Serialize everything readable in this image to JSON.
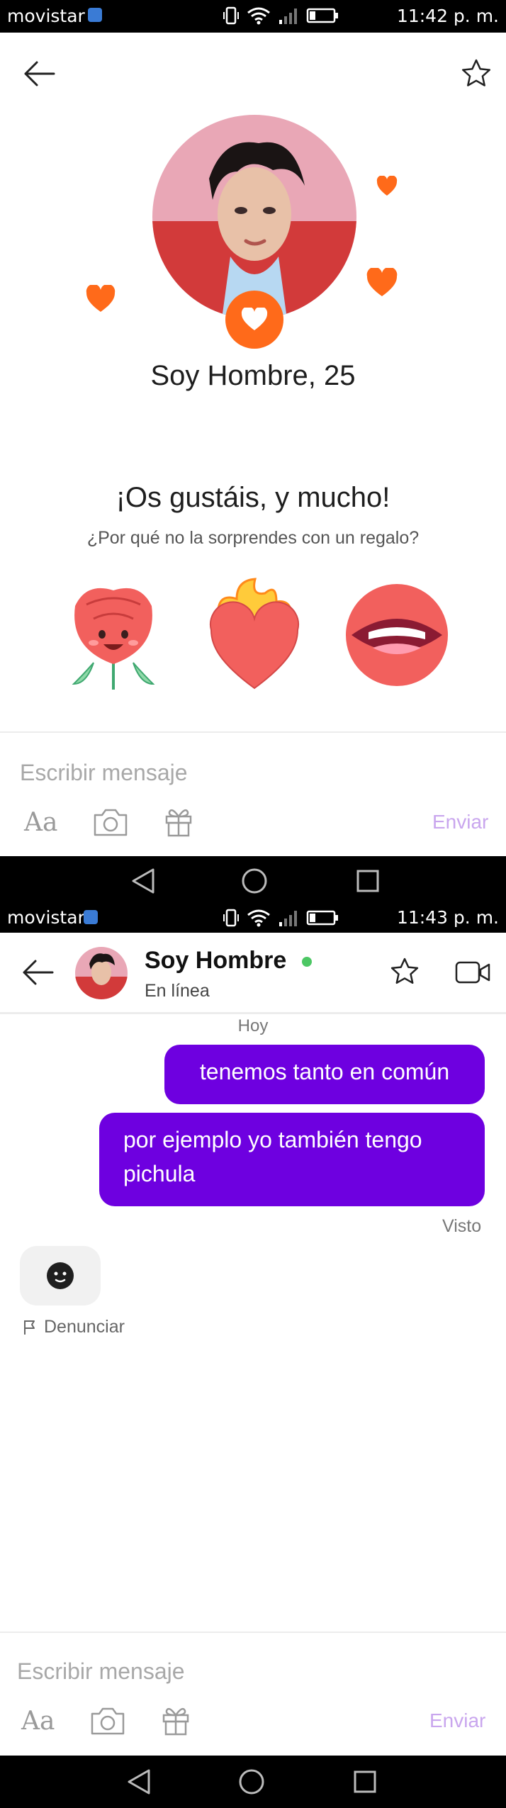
{
  "status_bar_1": {
    "carrier": "movistar",
    "time": "11:42 p. m."
  },
  "status_bar_2": {
    "carrier": "movistar",
    "time": "11:43 p. m."
  },
  "match_screen": {
    "profile_name": "Soy Hombre, 25",
    "headline": "¡Os gustáis, y mucho!",
    "subtitle": "¿Por qué no la sorprendes con un regalo?",
    "gifts": [
      "rose-gift",
      "fire-heart-gift",
      "lips-gift"
    ],
    "composer": {
      "placeholder": "Escribir mensaje",
      "send_label": "Enviar",
      "format_label": "Aa"
    }
  },
  "chat_screen": {
    "contact_name": "Soy Hombre",
    "presence": "En línea",
    "day_label": "Hoy",
    "messages": [
      {
        "from": "me",
        "text": "tenemos tanto en común"
      },
      {
        "from": "me",
        "text": "por ejemplo yo también tengo pichula"
      }
    ],
    "seen_label": "Visto",
    "report_label": "Denunciar",
    "composer": {
      "placeholder": "Escribir mensaje",
      "send_label": "Enviar",
      "format_label": "Aa"
    }
  },
  "colors": {
    "accent_orange": "#ff6a1a",
    "bubble_purple": "#6e00e0",
    "online_green": "#4cc764",
    "send_disabled": "#c9a6ee"
  }
}
